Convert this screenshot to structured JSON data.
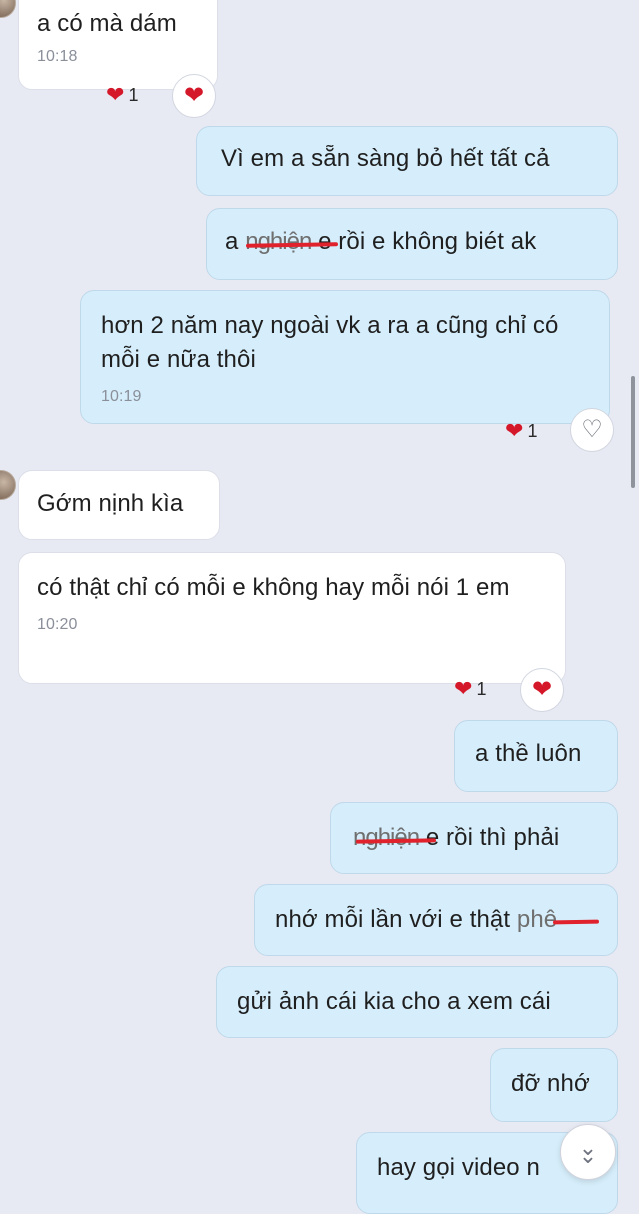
{
  "messages": [
    {
      "id": "m1",
      "text": "a có mà dám",
      "time": "10:18"
    },
    {
      "id": "m2",
      "text": "Vì em a sẵn sàng bỏ hết tất cả"
    },
    {
      "id": "m3",
      "text_before": "a ",
      "text_censored": "nghiện",
      "text_after": " e rồi e không biét ak"
    },
    {
      "id": "m4",
      "text": "hơn 2 năm nay ngoài vk a ra a cũng chỉ có mỗi e nữa thôi",
      "time": "10:19"
    },
    {
      "id": "m5",
      "text": "Gớm nịnh kìa"
    },
    {
      "id": "m6",
      "text": "có thật chỉ có mỗi e không hay mỗi nói 1 em",
      "time": "10:20"
    },
    {
      "id": "m7",
      "text": "a thề luôn"
    },
    {
      "id": "m8",
      "text_censored": "nghiện",
      "text_after": " e rồi thì phải"
    },
    {
      "id": "m9",
      "text_before": "nhớ mỗi lần với e thật ",
      "text_censored": "phê"
    },
    {
      "id": "m10",
      "text": "gửi ảnh cái kia cho a xem cái"
    },
    {
      "id": "m11",
      "text": "đỡ nhớ"
    },
    {
      "id": "m12",
      "text": "hay gọi video n"
    }
  ],
  "reactions": {
    "r1": {
      "icon": "heart",
      "count": "1"
    },
    "r2": {
      "icon": "heart",
      "count": "1"
    },
    "r3": {
      "icon": "heart",
      "count": "1"
    }
  },
  "icons": {
    "heart_glyph": "❤",
    "heart_outline_glyph": "♡",
    "chevron_glyph": "⌄"
  },
  "colors": {
    "background": "#e7e9f3",
    "incoming_bubble": "#ffffff",
    "outgoing_bubble": "#d6eefb",
    "heart": "#d4182a",
    "censor_line": "#e0222c"
  }
}
